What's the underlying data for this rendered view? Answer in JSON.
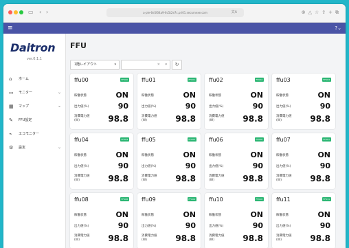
{
  "browser": {
    "url": "a-pie-6e5f04a9-6c5t2e7c.pri01.securnexe.com",
    "reader": "文A"
  },
  "app": {
    "logo": "Daitron",
    "version": "ver.0.1.1",
    "page_title": "FFU",
    "filters": {
      "layout_selected": "1階レイアウト",
      "clear": "×",
      "dropdown": "▾"
    }
  },
  "sidebar": {
    "items": [
      {
        "label": "ホーム",
        "icon": "home-icon",
        "has_children": false
      },
      {
        "label": "モニター",
        "icon": "monitor-icon",
        "has_children": true
      },
      {
        "label": "マップ",
        "icon": "map-icon",
        "has_children": true
      },
      {
        "label": "FFU設定",
        "icon": "wrench-icon",
        "has_children": false
      },
      {
        "label": "エコモニター",
        "icon": "eco-icon",
        "has_children": false
      },
      {
        "label": "設定",
        "icon": "gear-icon",
        "has_children": true
      }
    ]
  },
  "card_labels": {
    "status": "稼働状態",
    "output": "出力値(%)",
    "power_line1": "消費電力値",
    "power_line2": "(W)"
  },
  "cards": [
    {
      "name": "ffu00",
      "badge": "FFU00",
      "status": "ON",
      "output": "90",
      "power": "98.8"
    },
    {
      "name": "ffu01",
      "badge": "FFU01",
      "status": "ON",
      "output": "90",
      "power": "98.8"
    },
    {
      "name": "ffu02",
      "badge": "FFU02",
      "status": "ON",
      "output": "90",
      "power": "98.8"
    },
    {
      "name": "ffu03",
      "badge": "FFU03",
      "status": "ON",
      "output": "90",
      "power": "98.8"
    },
    {
      "name": "ffu04",
      "badge": "FFU04",
      "status": "ON",
      "output": "90",
      "power": "98.8"
    },
    {
      "name": "ffu05",
      "badge": "FFU05",
      "status": "ON",
      "output": "90",
      "power": "98.8"
    },
    {
      "name": "ffu06",
      "badge": "FFU06",
      "status": "ON",
      "output": "90",
      "power": "98.8"
    },
    {
      "name": "ffu07",
      "badge": "FFU07",
      "status": "ON",
      "output": "90",
      "power": "98.8"
    },
    {
      "name": "ffu08",
      "badge": "FFU08",
      "status": "ON",
      "output": "90",
      "power": "98.8"
    },
    {
      "name": "ffu09",
      "badge": "FFU09",
      "status": "ON",
      "output": "90",
      "power": "98.8"
    },
    {
      "name": "ffu10",
      "badge": "FFU10",
      "status": "ON",
      "output": "90",
      "power": "98.8"
    },
    {
      "name": "ffu11",
      "badge": "FFU11",
      "status": "ON",
      "output": "90",
      "power": "98.8"
    }
  ],
  "colors": {
    "appbar": "#4a54a6",
    "logo": "#1c2f6b",
    "badge": "#2bb673",
    "desktop": "#22b6c9"
  }
}
